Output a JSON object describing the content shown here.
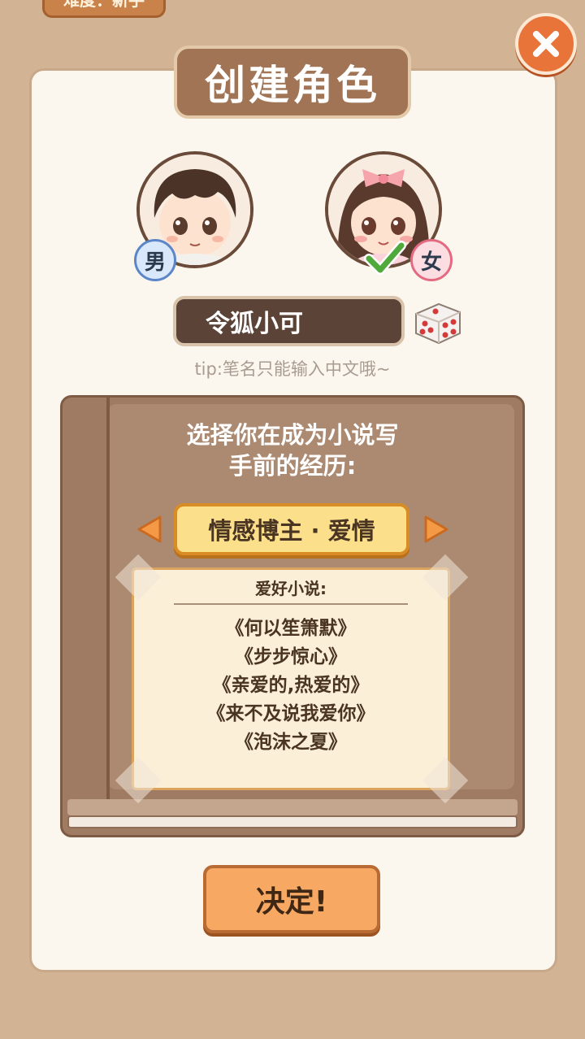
{
  "top_tab": {
    "label": "难度：新手"
  },
  "title": "创建角色",
  "avatars": {
    "male_badge": "男",
    "female_badge": "女",
    "selected": "female"
  },
  "name_field": {
    "value": "令狐小可"
  },
  "tip": "tip:笔名只能输入中文哦~",
  "experience": {
    "prompt_line1": "选择你在成为小说写",
    "prompt_line2": "手前的经历:",
    "selected": "情感博主 · 爱情"
  },
  "hobby": {
    "title": "爱好小说:",
    "novels": [
      "《何以笙箫默》",
      "《步步惊心》",
      "《亲爱的,热爱的》",
      "《来不及说我爱你》",
      "《泡沫之夏》"
    ]
  },
  "confirm_label": "决定!",
  "icons": [
    "close-icon",
    "dice-icon",
    "check-icon",
    "arrow-left-icon",
    "arrow-right-icon"
  ],
  "colors": {
    "panel": "#fcf7ee",
    "accent_orange": "#f7a862",
    "title_plate": "#a07454",
    "book": "#9f7b63"
  }
}
